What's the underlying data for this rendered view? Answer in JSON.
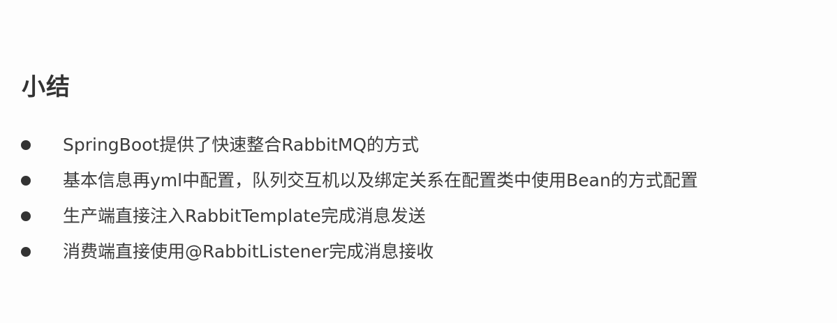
{
  "slide": {
    "title": "小结",
    "bullets": [
      {
        "text": "SpringBoot提供了快速整合RabbitMQ的方式"
      },
      {
        "text": "基本信息再yml中配置，队列交互机以及绑定关系在配置类中使用Bean的方式配置"
      },
      {
        "text": "生产端直接注入RabbitTemplate完成消息发送"
      },
      {
        "text": "消费端直接使用@RabbitListener完成消息接收"
      }
    ]
  }
}
